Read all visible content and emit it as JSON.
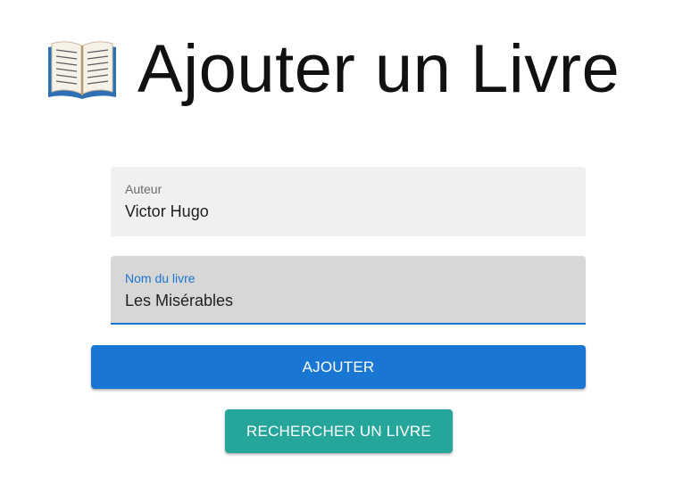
{
  "header": {
    "icon": "open-book-icon",
    "title": "Ajouter un Livre"
  },
  "form": {
    "author": {
      "label": "Auteur",
      "value": "Victor Hugo"
    },
    "book_name": {
      "label": "Nom du livre",
      "value": "Les Misérables"
    },
    "add_button": "AJOUTER",
    "search_button": "RECHERCHER UN LIVRE"
  },
  "colors": {
    "primary": "#1976d2",
    "secondary": "#26a69a"
  }
}
